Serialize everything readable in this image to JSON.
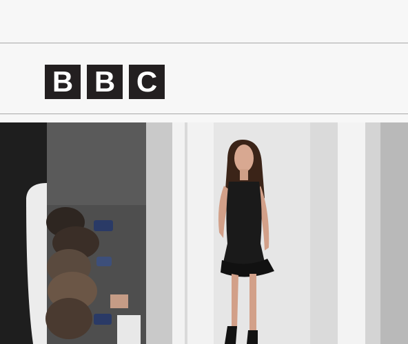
{
  "header": {
    "logo": {
      "letters": [
        "B",
        "B",
        "C"
      ],
      "block_color": "#231f20",
      "letter_color": "#ffffff"
    }
  },
  "hero": {
    "image_icon": "runway-photo",
    "colors": {
      "wall": "#e9e9e9",
      "left_shadow": "#1e1e1e",
      "dress": "#1a1a1a",
      "skin": "#d2a089",
      "hair": "#3b2418"
    }
  }
}
